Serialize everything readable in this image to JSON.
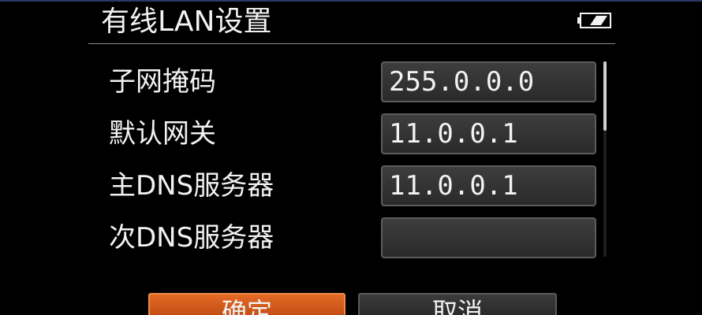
{
  "header": {
    "title": "有线LAN设置"
  },
  "fields": [
    {
      "label": "子网掩码",
      "value": "255.0.0.0"
    },
    {
      "label": "默认网关",
      "value": "11.0.0.1"
    },
    {
      "label": "主DNS服务器",
      "value": "11.0.0.1"
    },
    {
      "label": "次DNS服务器",
      "value": ""
    }
  ],
  "buttons": {
    "ok_label": "确定",
    "cancel_label": "取消"
  },
  "colors": {
    "accent": "#e46a24",
    "background": "#000000",
    "text": "#f2f2f2"
  },
  "icons": {
    "battery": "battery-icon"
  }
}
